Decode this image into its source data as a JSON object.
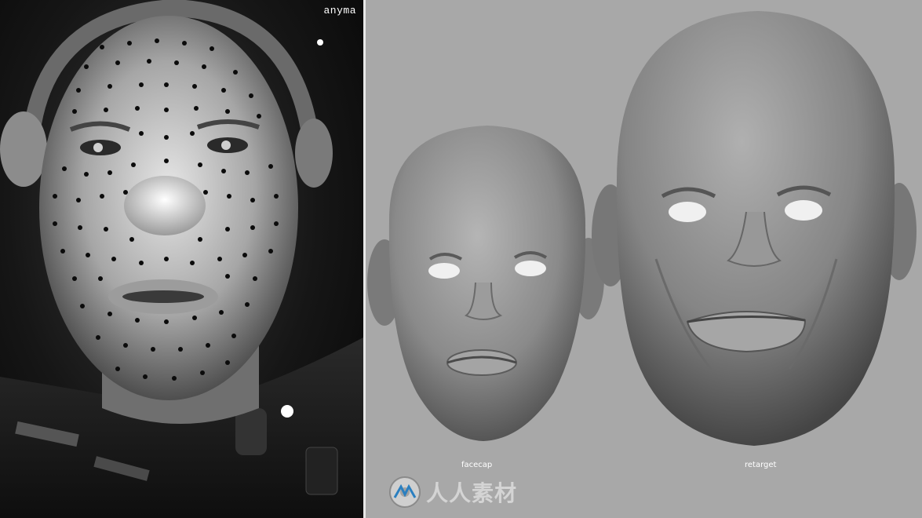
{
  "video": {
    "camera_label": "anyma",
    "mesh_labels": {
      "facecap": "facecap",
      "retarget": "retarget"
    },
    "watermark": {
      "text": "人人素材",
      "icon": "cd-logo-icon"
    }
  },
  "colors": {
    "viewport_bg": "#a8a8a8",
    "camera_bg": "#111111",
    "divider": "#e8e8e8",
    "mesh": "#8e8e8e"
  }
}
